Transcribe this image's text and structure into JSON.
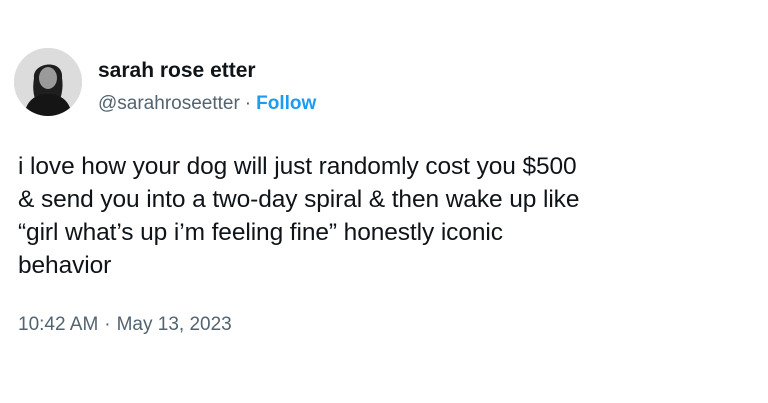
{
  "author": {
    "display_name": "sarah rose etter",
    "handle": "@sarahroseetter",
    "separator": "·",
    "follow_label": "Follow",
    "avatar_icon": "profile-photo-avatar"
  },
  "tweet": {
    "text": "i love how your dog will just randomly cost you $500\n& send you into a two-day spiral & then wake up like\n“girl what’s up i’m feeling fine” honestly iconic\nbehavior",
    "time": "10:42 AM",
    "date": "May 13, 2023",
    "meta_separator": "·"
  },
  "colors": {
    "text": "#0f1419",
    "secondary": "#536471",
    "follow": "#1d9bf0",
    "background": "#ffffff"
  }
}
